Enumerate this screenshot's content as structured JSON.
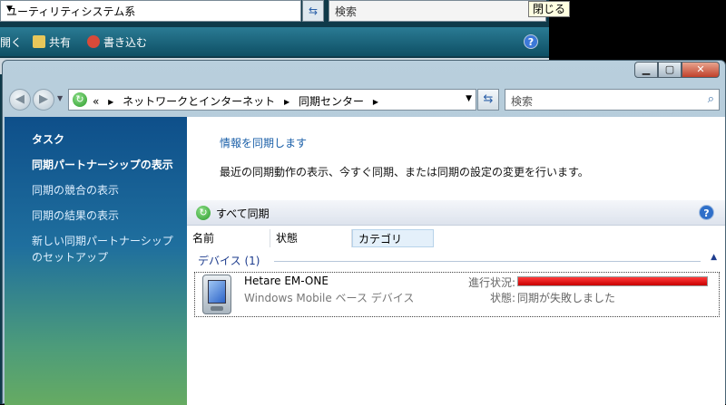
{
  "background_window": {
    "address": "ユーティリティシステム系",
    "search_placeholder": "検索",
    "toolbar": {
      "open": "開く",
      "share": "共有",
      "burn": "書き込む"
    },
    "tooltip": "閉じる"
  },
  "window": {
    "address": {
      "prefix": "«",
      "crumbs": [
        "ネットワークとインターネット",
        "同期センター"
      ]
    },
    "search_placeholder": "検索"
  },
  "sidebar": {
    "heading": "タスク",
    "items": [
      {
        "label": "同期パートナーシップの表示",
        "current": true
      },
      {
        "label": "同期の競合の表示",
        "current": false
      },
      {
        "label": "同期の結果の表示",
        "current": false
      },
      {
        "label": "新しい同期パートナーシップ",
        "current": false
      },
      {
        "label": "のセットアップ",
        "current": false
      }
    ]
  },
  "main": {
    "link": "情報を同期します",
    "description": "最近の同期動作の表示、今すぐ同期、または同期の設定の変更を行います。",
    "toolbar": {
      "sync_all": "すべて同期"
    },
    "columns": [
      "名前",
      "状態",
      "カテゴリ"
    ],
    "group": "デバイス (1)",
    "device": {
      "name": "Hetare EM-ONE",
      "type": "Windows Mobile ベース デバイス",
      "progress_label": "進行状況:",
      "progress_fraction": 1.0,
      "status_label": "状態:",
      "status_value": "同期が失敗しました"
    }
  },
  "colors": {
    "accent": "#1a5fa8",
    "progress": "#c80000",
    "sidebar": "#1f6f9e"
  }
}
